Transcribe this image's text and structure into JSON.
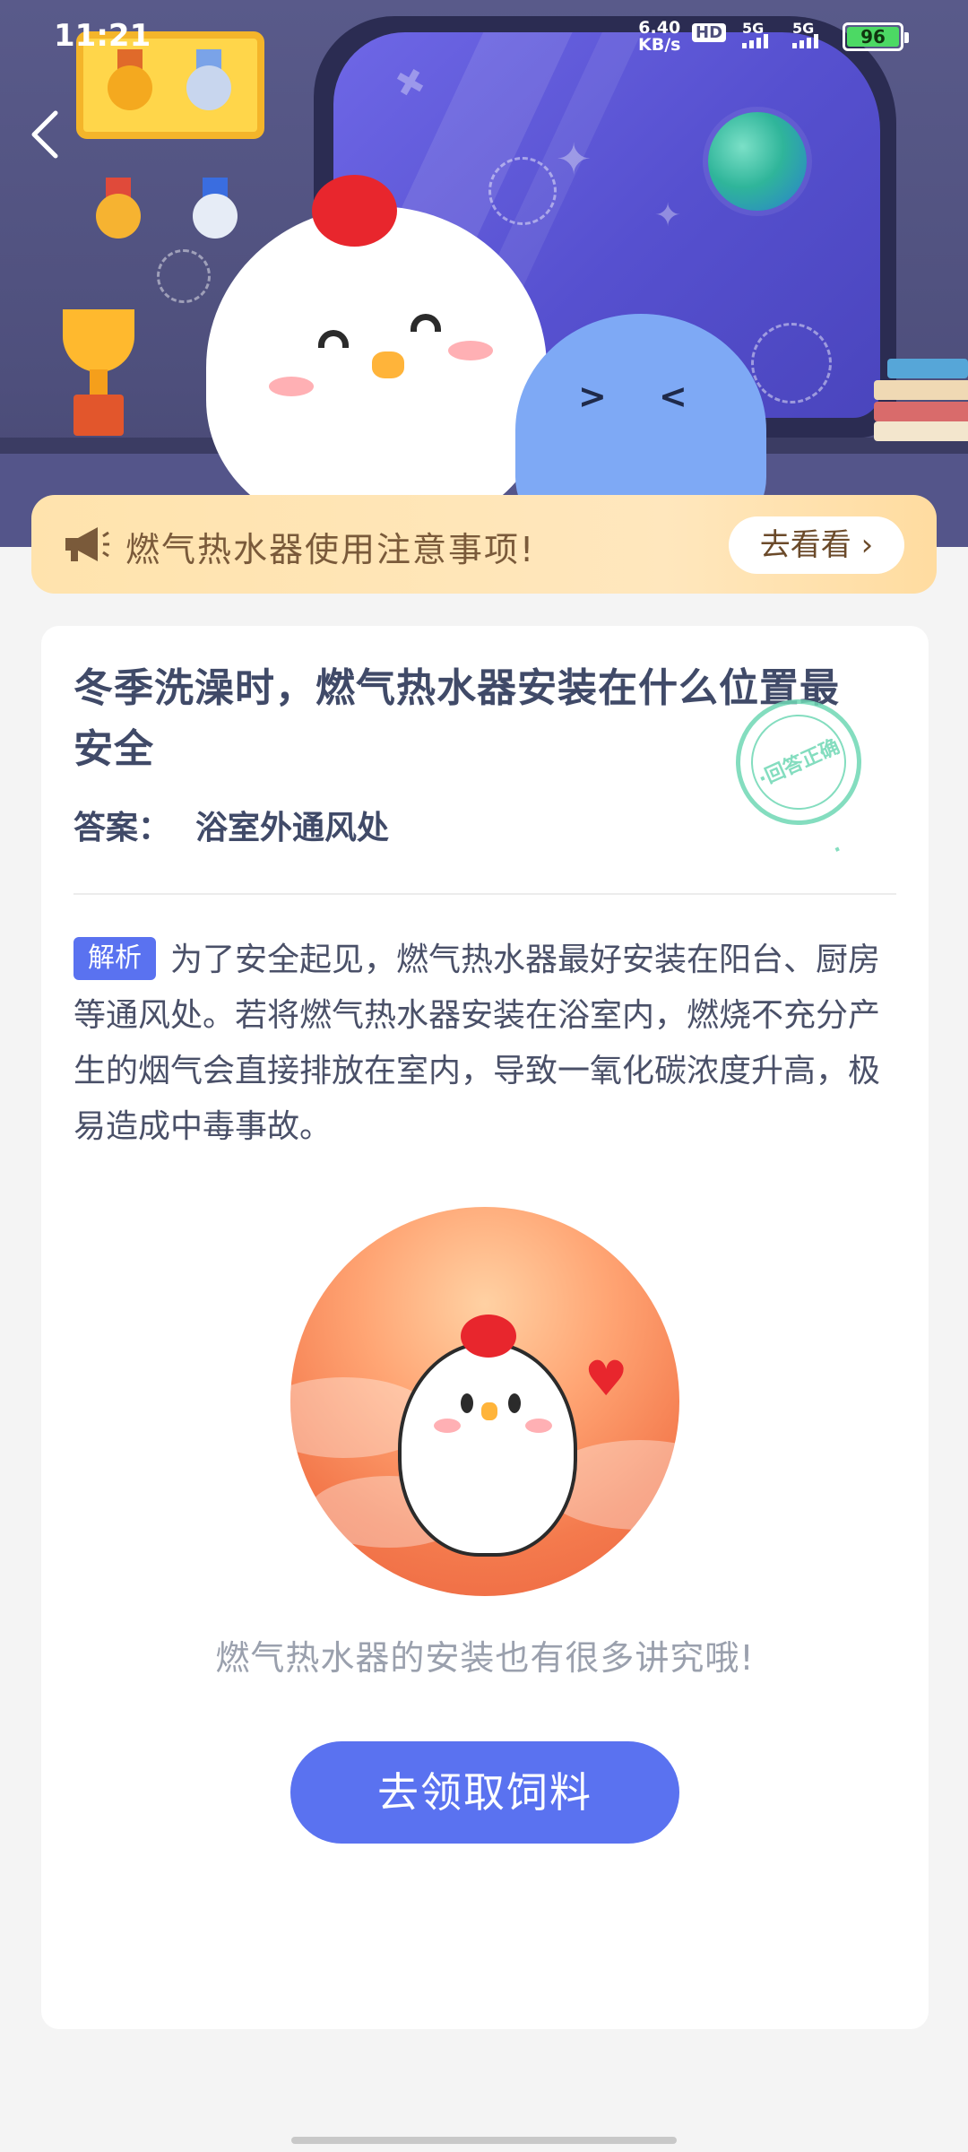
{
  "status_bar": {
    "time": "11:21",
    "net_speed_value": "6.40",
    "net_speed_unit": "KB/s",
    "hd_label": "HD",
    "signal_1": "5G",
    "signal_2": "5G",
    "battery": "96",
    "battery_color": "#4cd964"
  },
  "nav": {
    "back_icon": "chevron-left-icon"
  },
  "banner": {
    "icon": "megaphone-icon",
    "text": "燃气热水器使用注意事项!",
    "button_label": "去看看 ›"
  },
  "question": {
    "title": "冬季洗澡时，燃气热水器安装在什么位置最安全",
    "answer_label": "答案：",
    "answer_value": "浴室外通风处",
    "stamp_text": "·回答正确·"
  },
  "analysis": {
    "tag": "解析",
    "text": "为了安全起见，燃气热水器最好安装在阳台、厨房等通风处。若将燃气热水器安装在浴室内，燃烧不充分产生的烟气会直接排放在室内，导致一氧化碳浓度升高，极易造成中毒事故。"
  },
  "footer": {
    "caption": "燃气热水器的安装也有很多讲究哦!",
    "cta_label": "去领取饲料"
  },
  "colors": {
    "accent": "#5a72f0",
    "title": "#404a68",
    "banner_bg": "#ffe3ad",
    "stamp": "#6fd8b5"
  }
}
